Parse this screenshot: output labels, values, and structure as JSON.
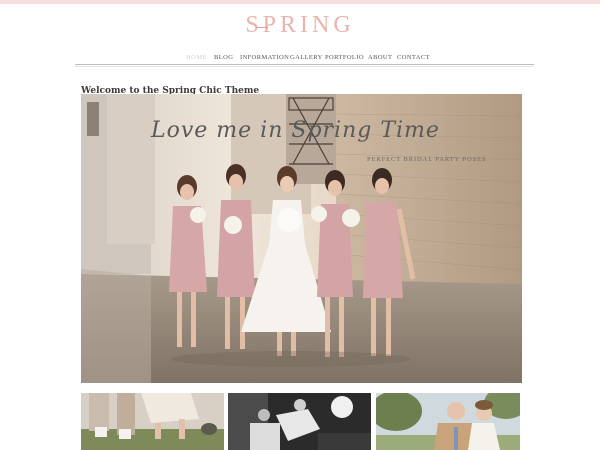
{
  "site": {
    "logo_text": "SPRING"
  },
  "nav": {
    "items": [
      {
        "label": "HOME",
        "active": true
      },
      {
        "label": "BLOG",
        "active": false
      },
      {
        "label": "INFORMATION",
        "active": false
      },
      {
        "label": "GALLERY",
        "active": false
      },
      {
        "label": "PORTFOLIO",
        "active": false
      },
      {
        "label": "ABOUT",
        "active": false
      },
      {
        "label": "CONTACT",
        "active": false
      }
    ]
  },
  "main": {
    "title": "Welcome to the Spring Chic Theme"
  },
  "hero": {
    "script_text": "Love me in Spring Time",
    "subtitle": "PERFECT BRIDAL PARTY POSES"
  },
  "colors": {
    "accent": "#e8b5ad",
    "top_bar": "#f6dede",
    "nav_text": "#555555",
    "nav_active": "#cfcfcf",
    "title_text": "#3b3b3b"
  }
}
